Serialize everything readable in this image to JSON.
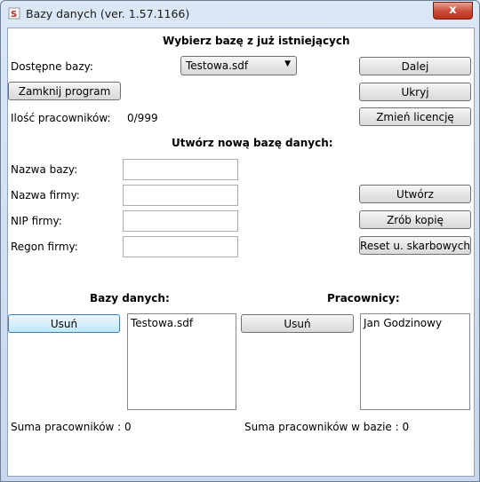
{
  "window": {
    "title": "Bazy danych (ver. 1.57.1166)",
    "close": "x"
  },
  "existing": {
    "heading": "Wybierz bazę z już istniejących",
    "available_label": "Dostępne bazy:",
    "selected_db": "Testowa.sdf",
    "close_program": "Zamknij program",
    "employees_label": "Ilość pracowników:",
    "employees_value": "0/999",
    "next": "Dalej",
    "hide": "Ukryj",
    "change_license": "Zmień licencję"
  },
  "create": {
    "heading": "Utwórz nową bazę danych:",
    "db_name_label": "Nazwa bazy:",
    "company_name_label": "Nazwa firmy:",
    "nip_label": "NIP firmy:",
    "regon_label": "Regon firmy:",
    "create_btn": "Utwórz",
    "backup_btn": "Zrób kopię",
    "reset_btn": "Reset u. skarbowych"
  },
  "databases": {
    "heading": "Bazy danych:",
    "delete": "Usuń",
    "items": [
      "Testowa.sdf"
    ],
    "sum": "Suma pracowników : 0"
  },
  "employees": {
    "heading": "Pracownicy:",
    "delete": "Usuń",
    "items": [
      "Jan Godzinowy"
    ],
    "sum": "Suma pracowników w bazie : 0"
  }
}
